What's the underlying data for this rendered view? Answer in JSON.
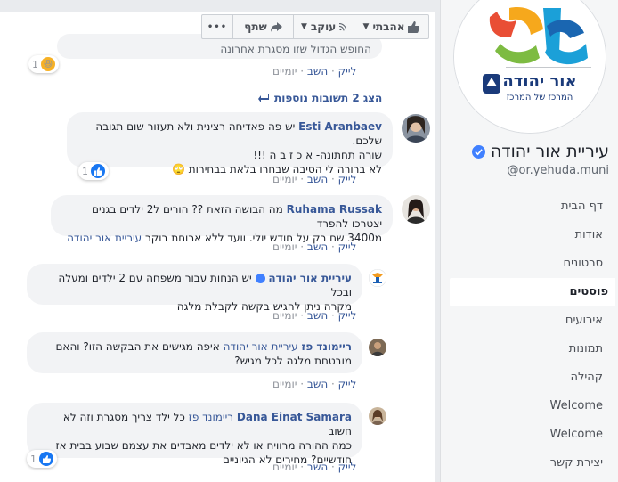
{
  "action_bar": {
    "like_label": "אהבתי",
    "follow_label": "עוקב",
    "share_label": "שתף",
    "more_label": "•••"
  },
  "sidebar": {
    "page_name": "עיריית אור יהודה",
    "handle": "@or.yehuda.muni",
    "logo_text_main": "אור יהודה",
    "logo_text_sub": "המרכז של המרכז",
    "nav": [
      {
        "label": "דף הבית"
      },
      {
        "label": "אודות"
      },
      {
        "label": "סרטונים"
      },
      {
        "label": "פוסטים"
      },
      {
        "label": "אירועים"
      },
      {
        "label": "תמונות"
      },
      {
        "label": "קהילה"
      },
      {
        "label": "Welcome"
      },
      {
        "label": "Welcome"
      },
      {
        "label": "יצירת קשר"
      }
    ]
  },
  "comments": [
    {
      "partial_text": "החופש הגדול שזו מסגרת אחרונה",
      "like": "לייק",
      "reply": "השב",
      "time": "יומיים",
      "reaction_count": "1"
    },
    {
      "more_replies": "הצג 2 תשובות נוספות"
    },
    {
      "author": "Esti Aranbaev",
      "line1": "יש פה פאדיחה רצינית ולא תעזור שום תגובה שלכם.",
      "line2": "שורה תחתונה- א כ ז ב ה !!!",
      "line3": "לא ברורה לי הסיבה שבחרו בלאת בבחירות",
      "like": "לייק",
      "reply": "השב",
      "time": "יומיים",
      "reaction_count": "1"
    },
    {
      "author": "Ruhama Russak",
      "line1": "מה הבושה הזאת ?? הורים ל2 ילדים בגנים יצטרכו להפרד",
      "line2_pre": "מ3400 שח רק על חודש יולי. וועד ללא ארוחת בוקר",
      "mention": "עיריית אור יהודה",
      "like": "לייק",
      "reply": "השב",
      "time": "יומיים"
    },
    {
      "author": "עיריית אור יהודה",
      "line1": "יש הנחות עבור משפחה עם 2 ילדים ומעלה ובכל",
      "line2": "מקרה ניתן להגיש בקשה לקבלת מלגה",
      "like": "לייק",
      "reply": "השב",
      "time": "יומיים"
    },
    {
      "author": "ריימונד פז",
      "mention": "עיריית אור יהודה",
      "line1_rest": "איפה מגישים את הבקשה הזו? והאם",
      "line2": "מובטחת מלגה לכל מגיש?",
      "like": "לייק",
      "reply": "השב",
      "time": "יומיים"
    },
    {
      "author": "Dana Einat Samara",
      "mention": "ריימונד פז",
      "line1_rest": "כל ילד צריך מסגרת וזה לא חשוב",
      "line2": "כמה ההורה מרוויח או לא ילדים מאבדים את עצמם שבוע בבית אז",
      "line3": "חודשיים? מחירים לא הגיוניים",
      "like": "לייק",
      "reply": "השב",
      "time": "יומיים",
      "reaction_count": "1"
    }
  ],
  "colors": {
    "link": "#385898",
    "bubble": "#f2f3f5",
    "like_blue": "#1877f2",
    "verified": "#4080ff"
  }
}
